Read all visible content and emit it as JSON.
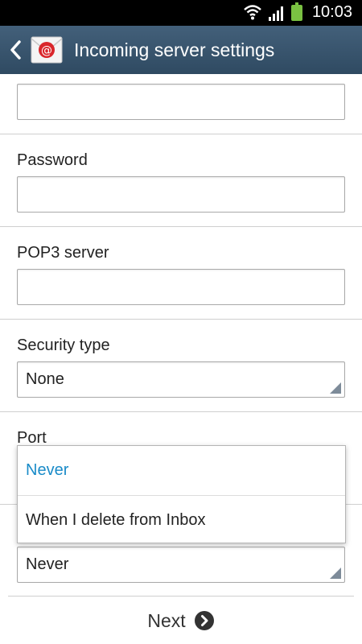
{
  "status_bar": {
    "time": "10:03"
  },
  "action_bar": {
    "title": "Incoming server settings"
  },
  "form": {
    "password_label": "Password",
    "password_value": "",
    "pop3_label": "POP3 server",
    "pop3_value": "",
    "security_label": "Security type",
    "security_value": "None",
    "port_label": "Port",
    "delete_value": "Never"
  },
  "dropdown": {
    "options": [
      "Never",
      "When I delete from Inbox"
    ],
    "selected": "Never"
  },
  "bottom": {
    "next_label": "Next"
  },
  "colors": {
    "accent": "#1a8bc8",
    "action_bar": "#3a566f"
  }
}
